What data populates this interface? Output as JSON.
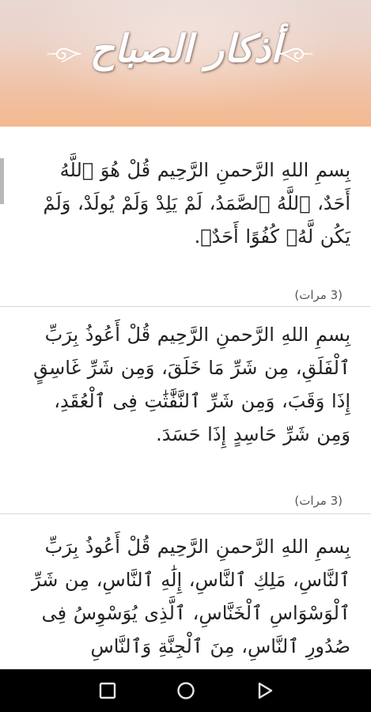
{
  "header": {
    "title": "أذكار الصباح"
  },
  "adhkar": [
    {
      "text": "بِسمِ اللهِ الرَّحمنِ الرَّحِيم قُلْ هُوَ ٱللَّهُ أَحَدٌ، ٱللَّهُ ٱلصَّمَدُ، لَمْ يَلِدْ وَلَمْ يُولَدْ، وَلَمْ يَكُن لَّهُۥ كُفُوًا أَحَدٌۢ.",
      "count": "(3 مرات)"
    },
    {
      "text": "بِسمِ اللهِ الرَّحمنِ الرَّحِيم قُلْ أَعُوذُ بِرَبِّ ٱلْفَلَقِ، مِن شَرِّ مَا خَلَقَ، وَمِن شَرِّ غَاسِقٍ إِذَا وَقَبَ، وَمِن شَرِّ ٱلنَّفَّٰثَٰتِ فِى ٱلْعُقَدِ، وَمِن شَرِّ حَاسِدٍ إِذَا حَسَدَ.",
      "count": "(3 مرات)"
    },
    {
      "text": "بِسمِ اللهِ الرَّحمنِ الرَّحِيم قُلْ أَعُوذُ بِرَبِّ ٱلنَّاسِ، مَلِكِ ٱلنَّاسِ، إِلَٰهِ ٱلنَّاسِ، مِن شَرِّ ٱلْوَسْوَاسِ ٱلْخَنَّاسِ، ٱلَّذِى يُوَسْوِسُ فِى صُدُورِ ٱلنَّاسِ، مِنَ ٱلْجِنَّةِ وَٱلنَّاسِ",
      "count": ""
    }
  ],
  "navigation": {
    "back": "back-icon",
    "home": "home-icon",
    "recents": "recents-icon"
  }
}
